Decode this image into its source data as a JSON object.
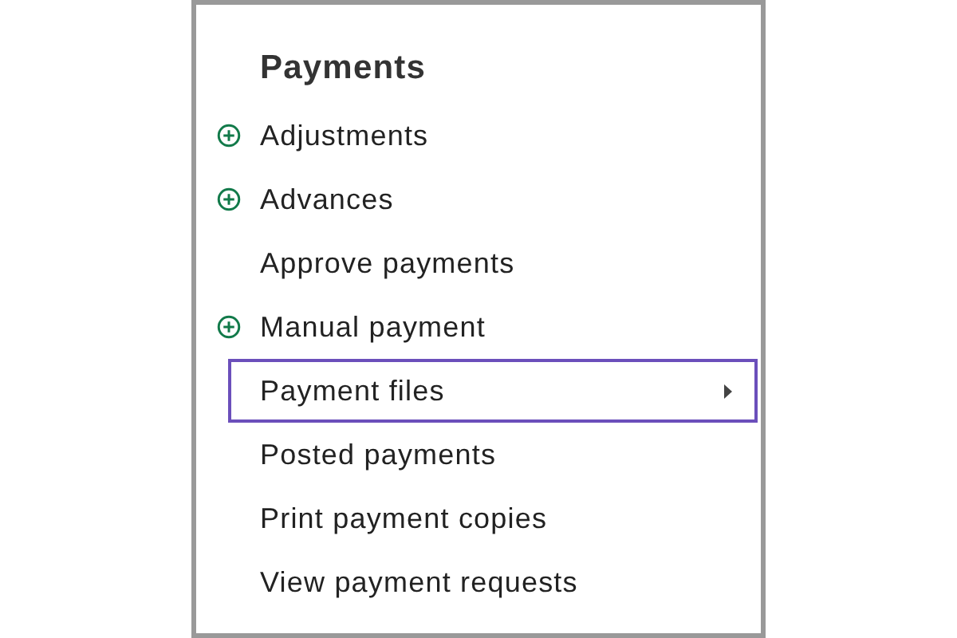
{
  "menu": {
    "title": "Payments",
    "items": [
      {
        "label": "Adjustments",
        "has_add": true,
        "has_submenu": false,
        "selected": false
      },
      {
        "label": "Advances",
        "has_add": true,
        "has_submenu": false,
        "selected": false
      },
      {
        "label": "Approve payments",
        "has_add": false,
        "has_submenu": false,
        "selected": false
      },
      {
        "label": "Manual payment",
        "has_add": true,
        "has_submenu": false,
        "selected": false
      },
      {
        "label": "Payment files",
        "has_add": false,
        "has_submenu": true,
        "selected": true
      },
      {
        "label": "Posted payments",
        "has_add": false,
        "has_submenu": false,
        "selected": false
      },
      {
        "label": "Print payment copies",
        "has_add": false,
        "has_submenu": false,
        "selected": false
      },
      {
        "label": "View payment requests",
        "has_add": false,
        "has_submenu": false,
        "selected": false
      }
    ]
  }
}
